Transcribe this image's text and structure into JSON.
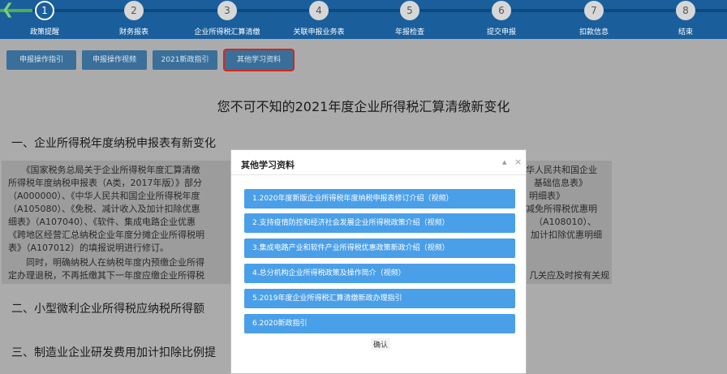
{
  "steps": [
    {
      "num": "1",
      "label": "政策提醒",
      "active": true
    },
    {
      "num": "2",
      "label": "财务报表",
      "active": false
    },
    {
      "num": "3",
      "label": "企业所得税汇算清缴",
      "active": false
    },
    {
      "num": "4",
      "label": "关联申报业务表",
      "active": false
    },
    {
      "num": "5",
      "label": "年报检查",
      "active": false
    },
    {
      "num": "6",
      "label": "提交申报",
      "active": false
    },
    {
      "num": "7",
      "label": "扣款信息",
      "active": false
    },
    {
      "num": "8",
      "label": "结束",
      "active": false
    }
  ],
  "tabs": [
    {
      "label": "申报操作指引"
    },
    {
      "label": "申报操作视频"
    },
    {
      "label": "2021新政指引"
    },
    {
      "label": "其他学习资料",
      "selected": true
    }
  ],
  "article": {
    "title": "您不可不知的2021年度企业所得税汇算清缴新变化",
    "sections": [
      "一、企业所得税年度纳税申报表有新变化",
      "二、小型微利企业所得税应纳税所得额",
      "三、制造业企业研发费用加计扣除比例提"
    ],
    "paragraph_lines": [
      "　　《国家税务总局关于企业所得税年度汇算清缴",
      "所得税年度纳税申报表（A类，2017年版）》部分",
      "（A000000）、《中华人民共和国企业所得税年度",
      "（A105080）、《免税、减计收入及加计扣除优惠",
      "细表》（A107040）、《软件、集成电路企业优惠",
      "《跨地区经营汇总纳税企业年度分摊企业所得税明",
      "表》（A107012）的填报说明进行修订。",
      "　　同时，明确纳税人在纳税年度内预缴企业所得",
      "定办理退税，不再抵缴其下一年度应缴企业所得税"
    ],
    "paragraph_right_lines": [
      "华人民共和国企业",
      "基础信息表》",
      "明细表》",
      "减免所得税优惠明",
      "（A108010）、",
      "加计扣除优惠明细",
      "",
      "",
      "几关应及时按有关规"
    ]
  },
  "modal": {
    "title": "其他学习资料",
    "min_symbol": "▲",
    "close_symbol": "×",
    "links": [
      "1.2020年度新版企业所得税年度纳税申报表修订介绍（视频）",
      "2.支持疫情防控和经济社会发展企业所得税政策介绍（视频）",
      "3.集成电路产业和软件产业所得税优惠政策新政介绍（视频）",
      "4.总分机构企业所得税政策及操作简介（视频）",
      "5.2019年度企业所得税汇算清缴新政办理指引",
      "6.2020新政指引"
    ],
    "confirm_label": "确认"
  },
  "icons": {
    "back": "back-arrow-icon"
  },
  "colors": {
    "nav_bg": "#1a5f9c",
    "link_bg": "#4a9fe9",
    "highlight": "#d9241b",
    "progress": "#4cae4c"
  }
}
